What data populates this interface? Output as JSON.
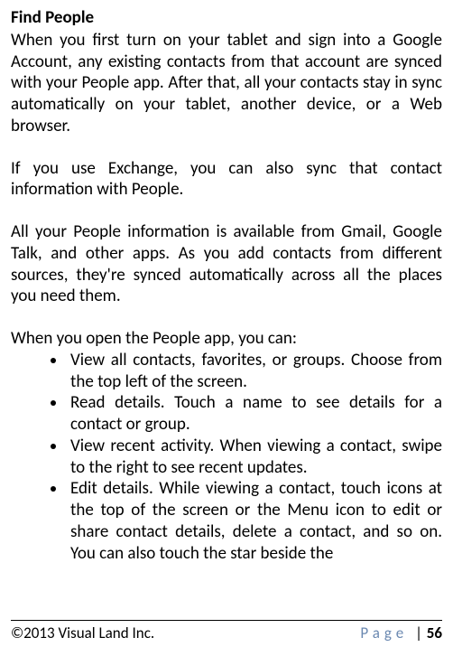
{
  "heading": "Find People",
  "paragraphs": {
    "p1": "When you first turn on your tablet and sign into a Google Account, any existing contacts from that account are synced with your People app. After that, all your contacts stay in sync automatically on your tablet, another device, or a Web browser.",
    "p2": "If you use Exchange, you can also sync that contact information with People.",
    "p3": "All your People information is available from Gmail, Google Talk, and other apps. As you add contacts from different sources, they're synced automatically across all the places you need them.",
    "p4": "When you open the People app, you can:"
  },
  "bullets": [
    "View all contacts, favorites, or groups. Choose from the top left of the screen.",
    "Read details. Touch a name to see details for a contact or group.",
    "View recent activity. When viewing a contact, swipe to the right to see recent updates.",
    "Edit details. While viewing a contact, touch icons at the top of the screen or the   Menu icon to edit or share contact details, delete a contact, and so on. You can also touch the star beside the"
  ],
  "footer": {
    "copyright": "©2013 Visual Land Inc.",
    "page_label": "Page",
    "separator": "|",
    "page_number": "56"
  }
}
